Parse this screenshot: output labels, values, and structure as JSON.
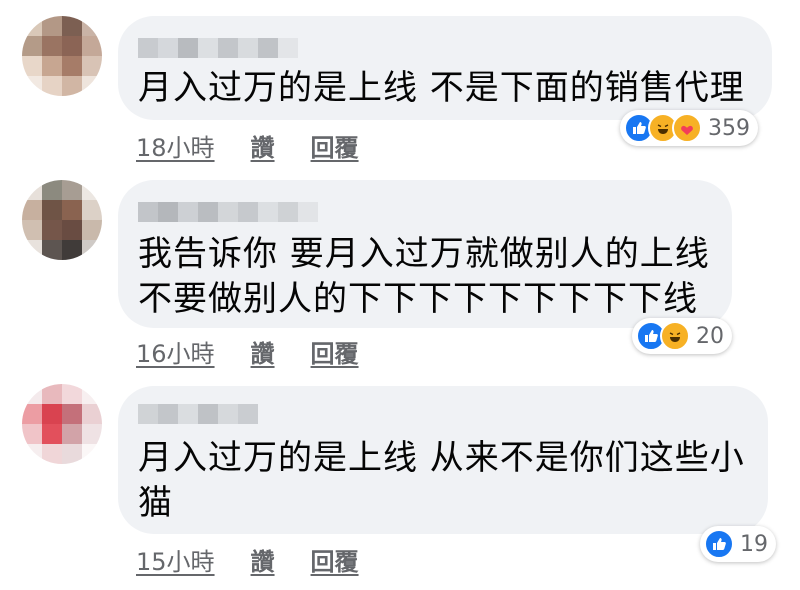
{
  "comments": [
    {
      "text": "月入过万的是上线 不是下面的销售代理",
      "time": "18小時",
      "like_label": "讚",
      "reply_label": "回覆",
      "reactions": [
        "like-icon",
        "laugh-icon",
        "care-icon"
      ],
      "reaction_count": "359"
    },
    {
      "text": "我告诉你 要月入过万就做别人的上线\n不要做别人的下下下下下下下下下线",
      "time": "16小時",
      "like_label": "讚",
      "reply_label": "回覆",
      "reactions": [
        "like-icon",
        "laugh-icon"
      ],
      "reaction_count": "20"
    },
    {
      "text": "月入过万的是上线 从来不是你们这些小\n猫",
      "time": "15小時",
      "like_label": "讚",
      "reply_label": "回覆",
      "reactions": [
        "like-icon"
      ],
      "reaction_count": "19"
    }
  ],
  "colors": {
    "bubble": "#f0f2f5",
    "meta_text": "#65676b",
    "like_blue": "#1877f2",
    "laugh_yellow": "#f7b125"
  }
}
